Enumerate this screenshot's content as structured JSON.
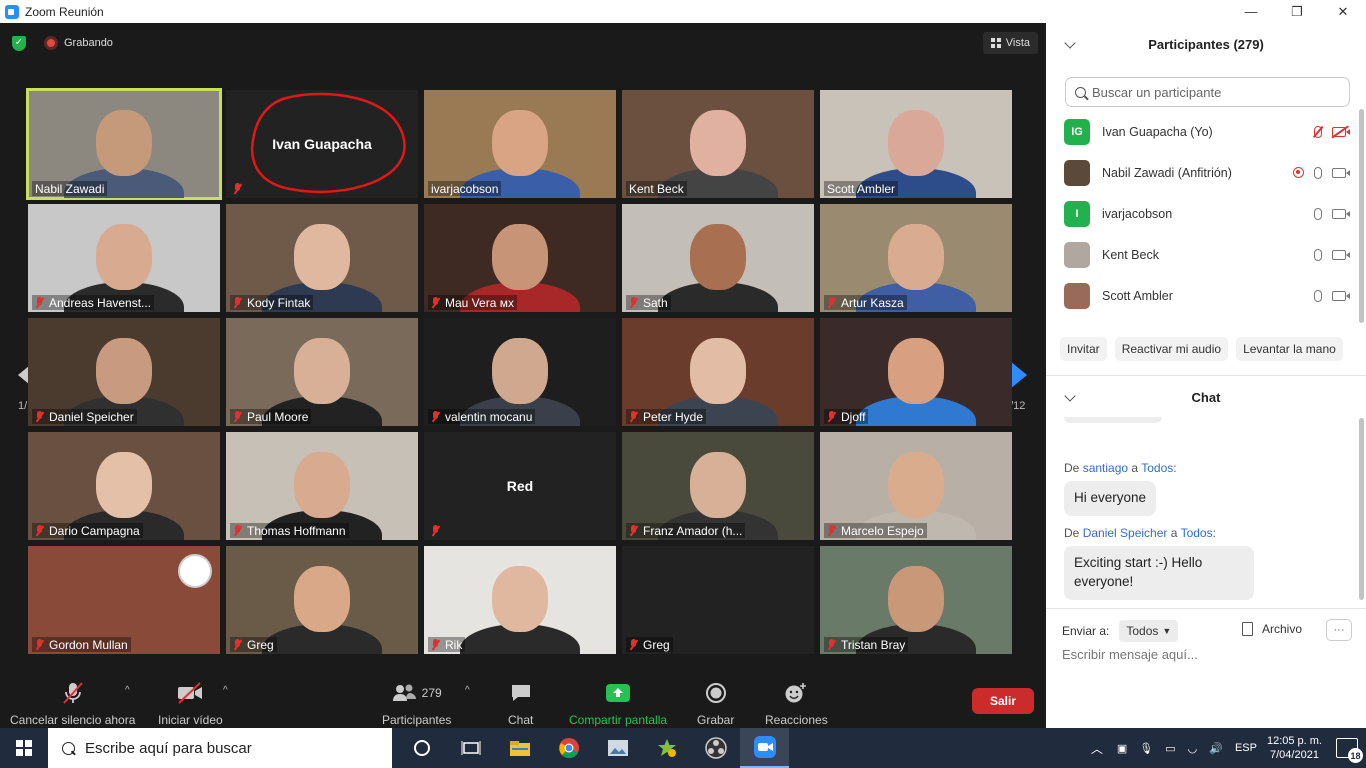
{
  "window": {
    "title": "Zoom Reunión",
    "controls": [
      "—",
      "❐",
      "✕"
    ]
  },
  "meeting": {
    "recording_label": "Grabando",
    "view_label": "Vista",
    "page_indicator_left": "1/12",
    "page_indicator_right": "1/12"
  },
  "tiles": [
    {
      "name": "Nabil Zawadi",
      "muted": false,
      "speaking": true,
      "video": true,
      "bg": "#8c8880",
      "skin": "#c49a7a",
      "shirt": "#4a5a78"
    },
    {
      "name": "",
      "muted": true,
      "video": false,
      "label": "Ivan Guapacha"
    },
    {
      "name": "ivarjacobson",
      "muted": false,
      "video": true,
      "bg": "#9a7a55",
      "skin": "#d8a484",
      "shirt": "#3a5fa8"
    },
    {
      "name": "Kent Beck",
      "muted": false,
      "video": true,
      "bg": "#6b5040",
      "skin": "#e0b0a0",
      "shirt": "#444"
    },
    {
      "name": "Scott Ambler",
      "muted": false,
      "video": true,
      "bg": "#c9c2b8",
      "skin": "#d9a898",
      "shirt": "#2d4c8a"
    },
    {
      "name": "Andreas Havenst...",
      "muted": true,
      "video": true,
      "bg": "#c8c8c8",
      "skin": "#d8aa90",
      "shirt": "#2b2b2b"
    },
    {
      "name": "Kody Fintak",
      "muted": true,
      "video": true,
      "bg": "#6f5a4a",
      "skin": "#e0b8a0",
      "shirt": "#2d3a52"
    },
    {
      "name": "Mau Vera ᴍx",
      "muted": true,
      "video": true,
      "bg": "#3e2a22",
      "skin": "#c79478",
      "shirt": "#a8282a"
    },
    {
      "name": "Sath",
      "muted": true,
      "video": true,
      "bg": "#c4beb8",
      "skin": "#a87050",
      "shirt": "#2a2a2a"
    },
    {
      "name": "Artur Kasza",
      "muted": true,
      "video": true,
      "bg": "#9a8a70",
      "skin": "#d9ac92",
      "shirt": "#3f5ea3"
    },
    {
      "name": "Daniel Speicher",
      "muted": true,
      "video": true,
      "bg": "#4b3a2e",
      "skin": "#c89a80",
      "shirt": "#303030"
    },
    {
      "name": "Paul Moore",
      "muted": true,
      "video": true,
      "bg": "#7a6a5a",
      "skin": "#d8b098",
      "shirt": "#222"
    },
    {
      "name": "valentin mocanu",
      "muted": true,
      "video": true,
      "bg": "#1e1e1e",
      "skin": "#d0a890",
      "shirt": "#3a3f4a"
    },
    {
      "name": "Peter Hyde",
      "muted": true,
      "video": true,
      "bg": "#6a3c2c",
      "skin": "#e2bca4",
      "shirt": "#3b4450"
    },
    {
      "name": "Djoff",
      "muted": true,
      "video": true,
      "bg": "#3a2a2a",
      "skin": "#d8a080",
      "shirt": "#2f7ad0"
    },
    {
      "name": "Dario Campagna",
      "muted": true,
      "video": true,
      "bg": "#6a5040",
      "skin": "#e4c0a8",
      "shirt": "#2a2a2a"
    },
    {
      "name": "Thomas Hoffmann",
      "muted": true,
      "video": true,
      "bg": "#c7c0b6",
      "skin": "#d8aa90",
      "shirt": "#222"
    },
    {
      "name": "",
      "muted": true,
      "video": false,
      "label": "Red"
    },
    {
      "name": "Franz Amador (h...",
      "muted": true,
      "video": true,
      "bg": "#4a4a3c",
      "skin": "#d8b098",
      "shirt": "#333"
    },
    {
      "name": "Marcelo Espejo",
      "muted": true,
      "video": true,
      "bg": "#b8b0a6",
      "skin": "#d8ac8c",
      "shirt": "#bfb8ae"
    },
    {
      "name": "Gordon Mullan",
      "muted": true,
      "video": true,
      "bg": "#8a4a3a",
      "skin": "#000",
      "shirt": "#000",
      "empty": true
    },
    {
      "name": "Greg",
      "muted": true,
      "video": true,
      "bg": "#6a5a48",
      "skin": "#d8a888",
      "shirt": "#2a2a2a"
    },
    {
      "name": "Rik",
      "muted": true,
      "video": true,
      "bg": "#e6e4e0",
      "skin": "#e0b8a0",
      "shirt": "#2a2a2a"
    },
    {
      "name": "Greg",
      "muted": true,
      "video": false,
      "label": ""
    },
    {
      "name": "Tristan Bray",
      "muted": true,
      "video": true,
      "bg": "#6a7a68",
      "skin": "#c89878",
      "shirt": "#2a2a2a"
    }
  ],
  "toolbar": {
    "unmute_label": "Cancelar silencio ahora",
    "video_label": "Iniciar vídeo",
    "participants_label": "Participantes",
    "participants_count": "279",
    "chat_label": "Chat",
    "share_label": "Compartir pantalla",
    "record_label": "Grabar",
    "reactions_label": "Reacciones",
    "exit_label": "Salir"
  },
  "participants_panel": {
    "title": "Participantes (279)",
    "search_placeholder": "Buscar un participante",
    "list": [
      {
        "initials": "IG",
        "avatar_color": "#23b14d",
        "name": "Ivan Guapacha (Yo)",
        "mic_off": true,
        "cam_off": true,
        "recording": false
      },
      {
        "initials": "",
        "avatar_color": "#5b4a3a",
        "name": "Nabil Zawadi (Anfitrión)",
        "mic_off": false,
        "cam_off": false,
        "recording": true
      },
      {
        "initials": "I",
        "avatar_color": "#23b14d",
        "name": "ivarjacobson",
        "mic_off": false,
        "cam_off": false,
        "recording": false
      },
      {
        "initials": "",
        "avatar_color": "#b0a8a0",
        "name": "Kent Beck",
        "mic_off": false,
        "cam_off": false,
        "recording": false
      },
      {
        "initials": "",
        "avatar_color": "#9a6a58",
        "name": "Scott Ambler",
        "mic_off": false,
        "cam_off": false,
        "recording": false
      }
    ],
    "invite_label": "Invitar",
    "reactivate_audio_label": "Reactivar mi audio",
    "raise_hand_label": "Levantar la mano"
  },
  "chat": {
    "title": "Chat",
    "messages": [
      {
        "prefix": "De",
        "from": "santiago",
        "to_word": "a",
        "to": "Todos",
        "suffix": ":",
        "text": "Hi everyone"
      },
      {
        "prefix": "De",
        "from": "Daniel Speicher",
        "to_word": "a",
        "to": "Todos",
        "suffix": ":",
        "text": "Exciting start :-) Hello everyone!"
      }
    ],
    "send_to_label": "Enviar a:",
    "send_to_value": "Todos",
    "file_label": "Archivo",
    "more_label": "···",
    "message_placeholder": "Escribir mensaje aquí..."
  },
  "taskbar": {
    "search_placeholder": "Escribe aquí para buscar",
    "language": "ESP",
    "time": "12:05 p. m.",
    "date": "7/04/2021",
    "notifications": "18"
  }
}
